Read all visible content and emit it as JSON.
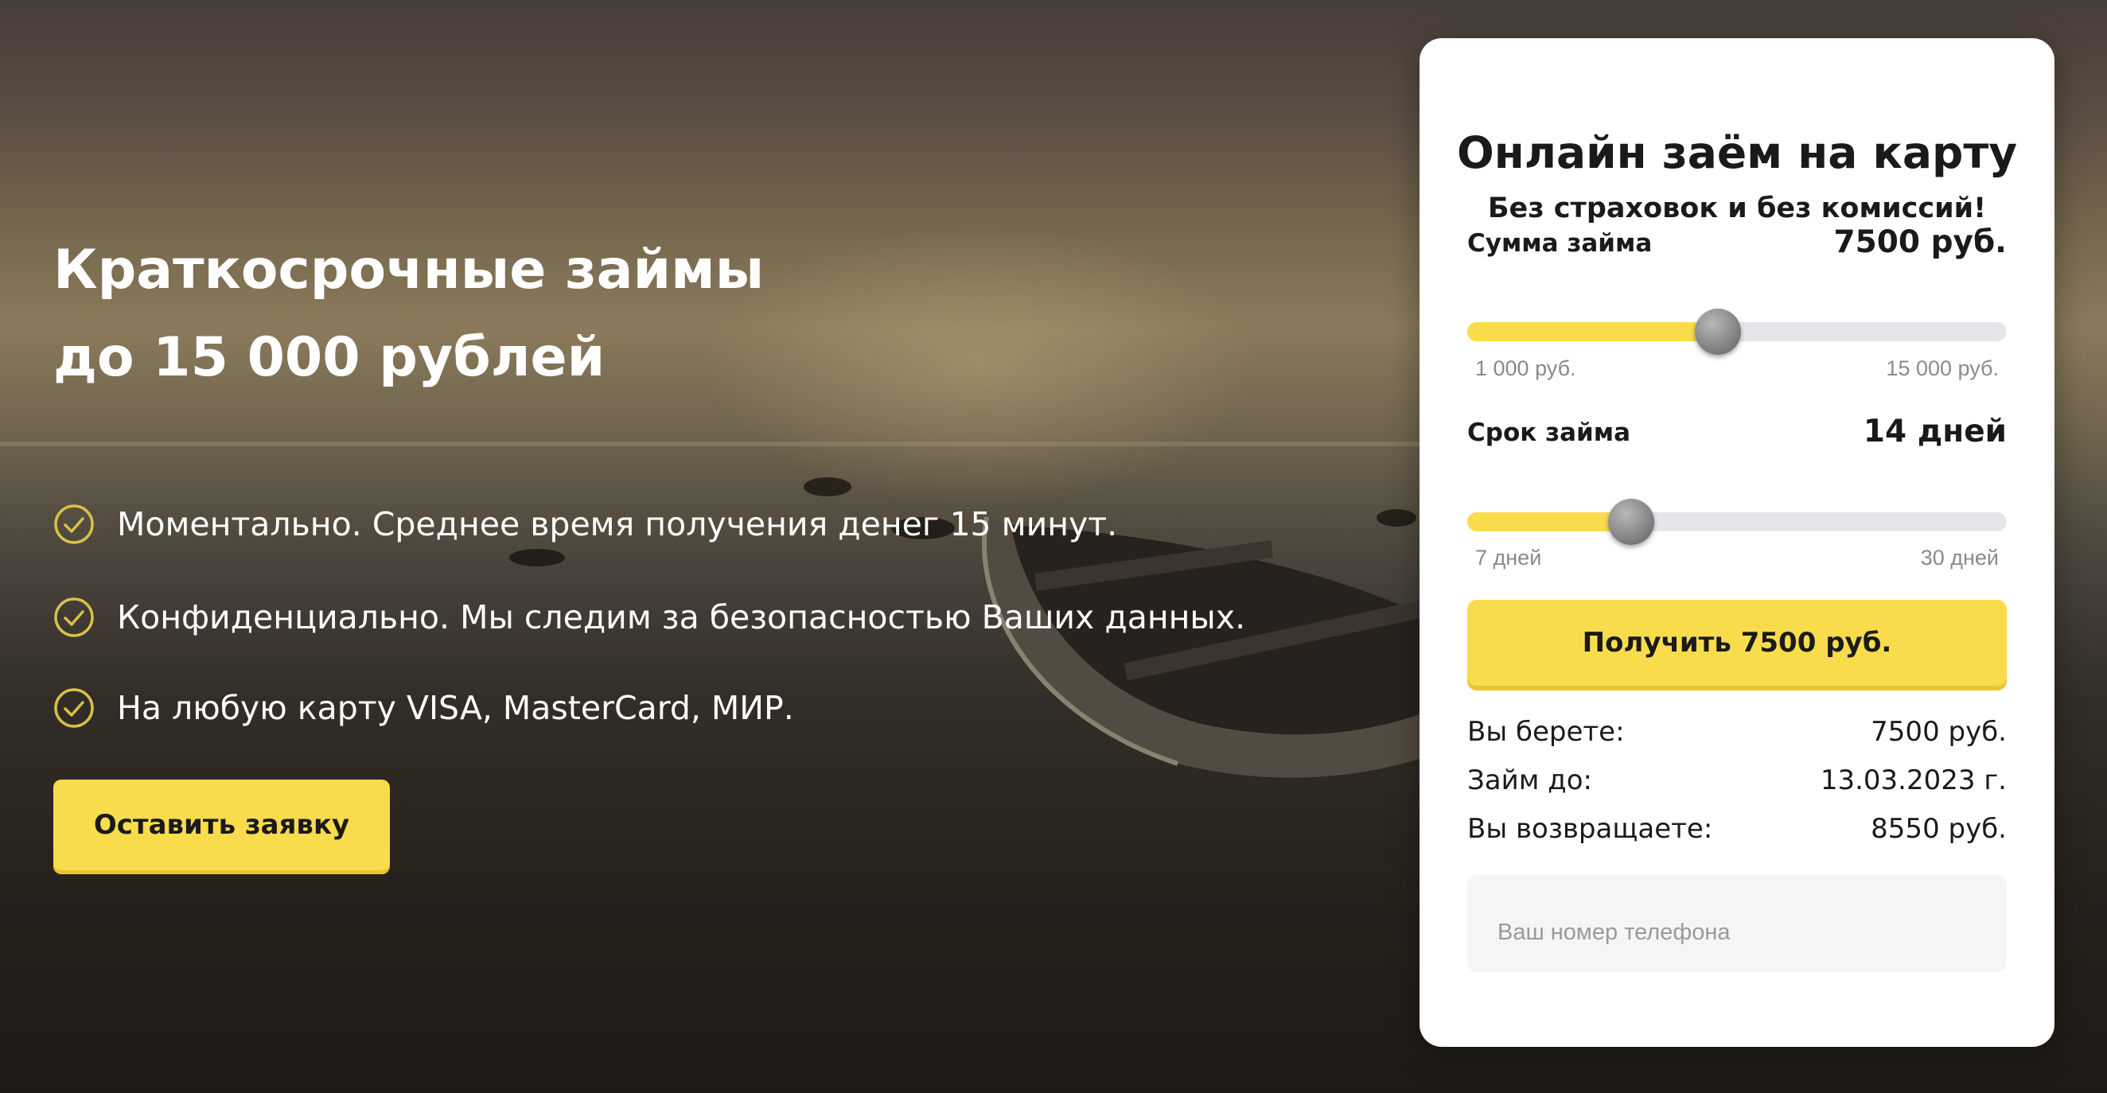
{
  "hero": {
    "headline_line1": "Краткосрочные займы",
    "headline_line2": "до 15 000 рублей",
    "benefits": [
      {
        "icon": "check-circle-icon",
        "text": "Моментально. Среднее время получения денег 15 минут."
      },
      {
        "icon": "check-circle-icon",
        "text": "Конфиденциально. Мы следим за безопасностью Ваших данных."
      },
      {
        "icon": "check-circle-icon",
        "text": "На любую карту VISA, MasterCard, МИР."
      }
    ],
    "apply_button": "Оставить заявку"
  },
  "calculator": {
    "title": "Онлайн заём на карту",
    "subtitle": "Без страховок и без комиссий!",
    "amount": {
      "label": "Сумма займа",
      "value_text": "7500 руб.",
      "min_label": "1 000 руб.",
      "max_label": "15 000 руб.",
      "value": 7500,
      "min": 1000,
      "max": 15000
    },
    "term": {
      "label": "Срок займа",
      "value_text": "14 дней",
      "min_label": "7 дней",
      "max_label": "30 дней",
      "value": 14,
      "min": 7,
      "max": 30
    },
    "get_button": "Получить 7500 руб.",
    "summary": [
      {
        "label": "Вы берете:",
        "value": "7500 руб."
      },
      {
        "label": "Займ до:",
        "value": "13.03.2023 г."
      },
      {
        "label": "Вы возвращаете:",
        "value": "8550 руб."
      }
    ],
    "phone_placeholder": "Ваш номер телефона",
    "phone_value": ""
  },
  "colors": {
    "accent": "#f9dc4c",
    "accent_shadow": "#e8c630",
    "track": "#e6e6ea",
    "check_icon": "#d9c04a",
    "text_dark": "#1a1a1a",
    "muted": "#8a8a8a"
  }
}
